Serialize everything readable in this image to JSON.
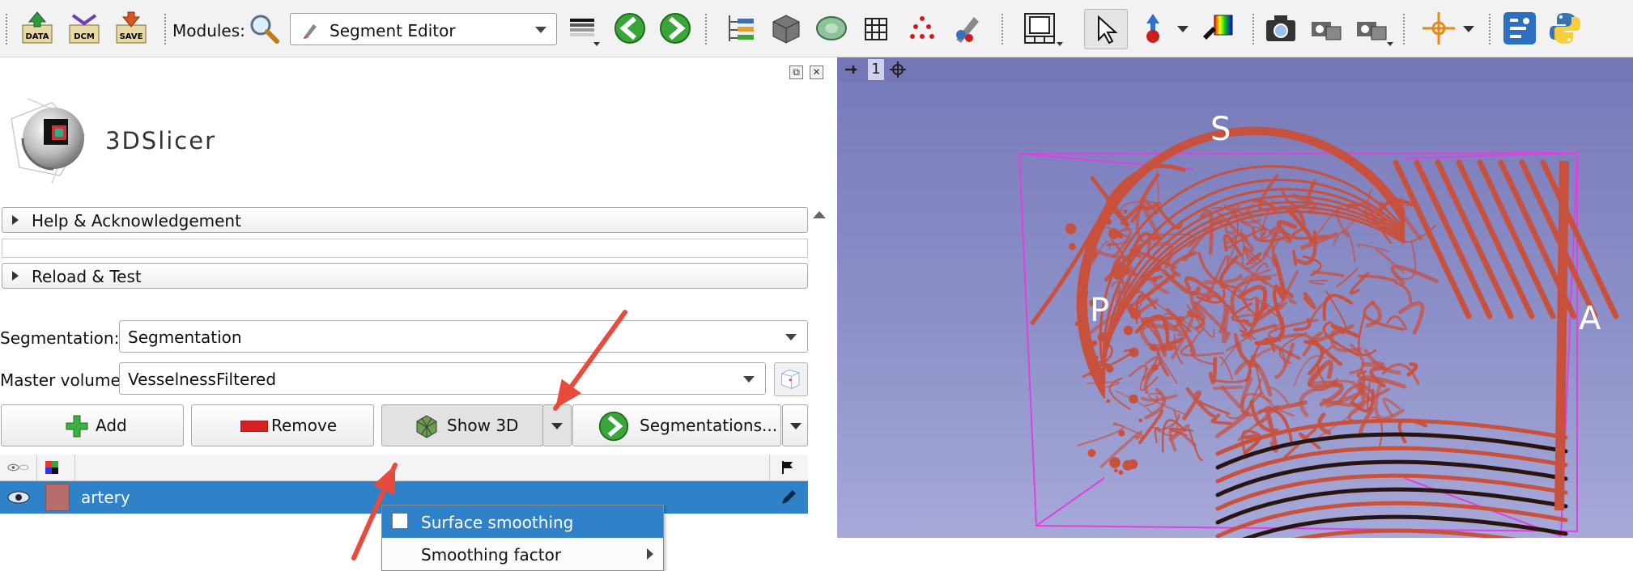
{
  "toolbar": {
    "modules_label": "Modules:",
    "module_selected": "Segment Editor",
    "icons": {
      "data": "DATA",
      "dcm": "DCM",
      "save": "SAVE"
    }
  },
  "panel": {
    "logo_text": "3DSlicer",
    "sections": {
      "help": "Help & Acknowledgement",
      "reload": "Reload & Test"
    },
    "segmentation_label": "Segmentation:",
    "segmentation_value": "Segmentation",
    "master_volume_label": "Master volume:",
    "master_volume_value": "VesselnessFiltered",
    "buttons": {
      "add": "Add",
      "remove": "Remove",
      "show3d": "Show 3D",
      "segmentations": "Segmentations..."
    },
    "table": {
      "rows": [
        {
          "name": "artery",
          "color": "#b76d6d"
        }
      ]
    },
    "menu": {
      "surface_smoothing": "Surface smoothing",
      "surface_smoothing_checked": false,
      "smoothing_factor": "Smoothing factor"
    }
  },
  "view3d": {
    "view_number": "1",
    "labels": {
      "superior": "S",
      "posterior": "P",
      "anterior": "A"
    },
    "volume_color": "#c8513e",
    "box_color": "#e040e0"
  },
  "annotations": {
    "arrow_color": "#e84a3c"
  }
}
